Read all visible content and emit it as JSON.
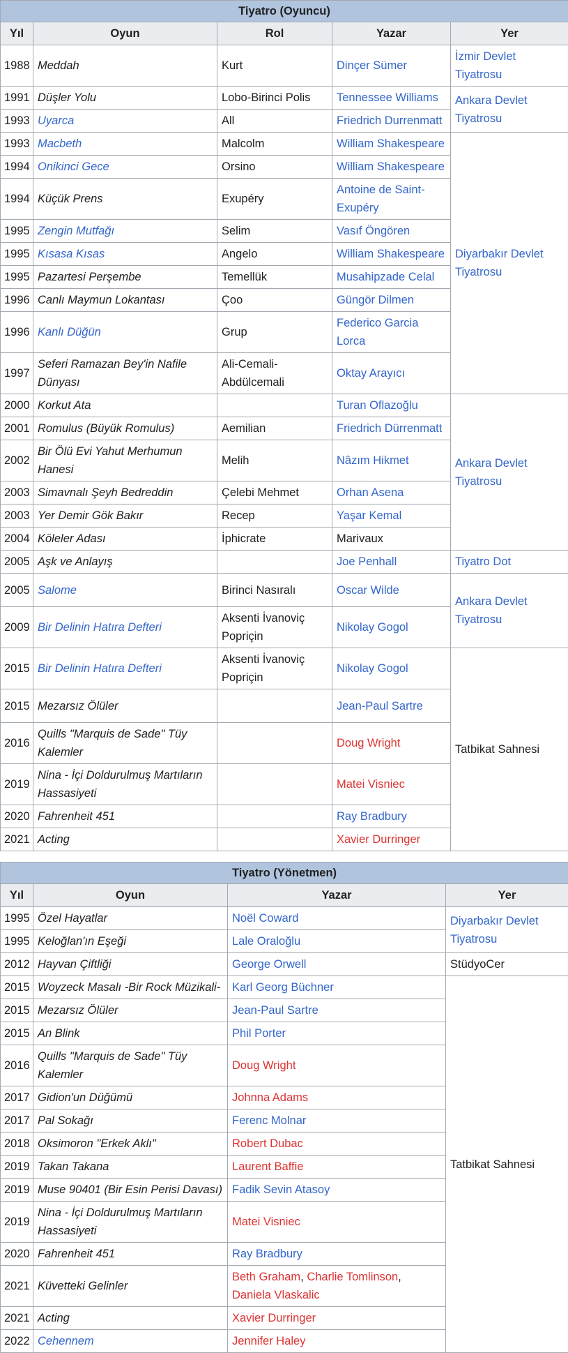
{
  "table_actor": {
    "caption": "Tiyatro (Oyuncu)",
    "headers": [
      "Yıl",
      "Oyun",
      "Rol",
      "Yazar",
      "Yer"
    ],
    "rows": [
      {
        "year": "1988",
        "play": "Meddah",
        "role": "Kurt",
        "author": "Dinçer Sümer",
        "venue": "İzmir Devlet Tiyatrosu"
      },
      {
        "year": "1991",
        "play": "Düşler Yolu",
        "role": "Lobo-Birinci Polis",
        "author": "Tennessee Williams",
        "venue": "Ankara Devlet Tiyatrosu"
      },
      {
        "year": "1993",
        "play": "Uyarca",
        "role": "All",
        "author": "Friedrich Durrenmatt"
      },
      {
        "year": "1993",
        "play": "Macbeth",
        "role": "Malcolm",
        "author": "William Shakespeare",
        "venue": "Diyarbakır Devlet Tiyatrosu"
      },
      {
        "year": "1994",
        "play": "Onikinci Gece",
        "role": "Orsino",
        "author": "William Shakespeare"
      },
      {
        "year": "1994",
        "play": "Küçük Prens",
        "role": "Exupéry",
        "author": "Antoine de Saint-Exupéry"
      },
      {
        "year": "1995",
        "play": "Zengin Mutfağı",
        "role": "Selim",
        "author": "Vasıf Öngören"
      },
      {
        "year": "1995",
        "play": "Kısasa Kısas",
        "role": "Angelo",
        "author": "William Shakespeare"
      },
      {
        "year": "1995",
        "play": "Pazartesi Perşembe",
        "role": "Temellük",
        "author": "Musahipzade Celal"
      },
      {
        "year": "1996",
        "play": "Canlı Maymun Lokantası",
        "role": "Çoo",
        "author": "Güngör Dilmen"
      },
      {
        "year": "1996",
        "play": "Kanlı Düğün",
        "role": "Grup",
        "author": "Federico Garcia Lorca"
      },
      {
        "year": "1997",
        "play": "Seferi Ramazan Bey'in Nafile Dünyası",
        "role": "Ali-Cemali-Abdülcemali",
        "author": "Oktay Arayıcı"
      },
      {
        "year": "2000",
        "play": "Korkut Ata",
        "role": "",
        "author": "Turan Oflazoğlu",
        "venue": "Ankara Devlet Tiyatrosu"
      },
      {
        "year": "2001",
        "play": "Romulus (Büyük Romulus)",
        "role": "Aemilian",
        "author": "Friedrich Dürrenmatt"
      },
      {
        "year": "2002",
        "play": "Bir Ölü Evi Yahut Merhumun Hanesi",
        "role": "Melih",
        "author": "Nâzım Hikmet"
      },
      {
        "year": "2003",
        "play": "Simavnalı Şeyh Bedreddin",
        "role": "Çelebi Mehmet",
        "author": "Orhan Asena"
      },
      {
        "year": "2003",
        "play": "Yer Demir Gök Bakır",
        "role": "Recep",
        "author": "Yaşar Kemal"
      },
      {
        "year": "2004",
        "play": "Köleler Adası",
        "role": "İphicrate",
        "author": "Marivaux"
      },
      {
        "year": "2005",
        "play": "Aşk ve Anlayış",
        "role": "",
        "author": "Joe Penhall",
        "venue": "Tiyatro Dot"
      },
      {
        "year": "2005",
        "play": "Salome",
        "role": "Birinci Nasıralı",
        "author": "Oscar Wilde",
        "venue": "Ankara Devlet Tiyatrosu"
      },
      {
        "year": "2009",
        "play": "Bir Delinin Hatıra Defteri",
        "role": "Aksenti İvanoviç Popriçin",
        "author": "Nikolay Gogol"
      },
      {
        "year": "2015",
        "play": "Bir Delinin Hatıra Defteri",
        "role": "Aksenti İvanoviç Popriçin",
        "author": "Nikolay Gogol",
        "venue": "Tatbikat Sahnesi"
      },
      {
        "year": "2015",
        "play": "Mezarsız Ölüler",
        "role": "",
        "author": "Jean-Paul Sartre"
      },
      {
        "year": "2016",
        "play": "Quills \"Marquis de Sade\" Tüy Kalemler",
        "role": "",
        "author": "Doug Wright"
      },
      {
        "year": "2019",
        "play": "Nina - İçi Doldurulmuş Martıların Hassasiyeti",
        "role": "",
        "author": "Matei Visniec"
      },
      {
        "year": "2020",
        "play": "Fahrenheit 451",
        "role": "",
        "author": "Ray Bradbury"
      },
      {
        "year": "2021",
        "play": "Acting",
        "role": "",
        "author": "Xavier Durringer"
      }
    ]
  },
  "table_director": {
    "caption": "Tiyatro (Yönetmen)",
    "headers": [
      "Yıl",
      "Oyun",
      "Yazar",
      "Yer"
    ],
    "rows": [
      {
        "year": "1995",
        "play": "Özel Hayatlar",
        "author": "Noël Coward",
        "venue": "Diyarbakır Devlet Tiyatrosu"
      },
      {
        "year": "1995",
        "play": "Keloğlan'ın Eşeği",
        "author": "Lale Oraloğlu"
      },
      {
        "year": "2012",
        "play": "Hayvan Çiftliği",
        "author": "George Orwell",
        "venue": "StüdyoCer"
      },
      {
        "year": "2015",
        "play": "Woyzeck Masalı -Bir Rock Müzikali-",
        "author": "Karl Georg Büchner",
        "venue": "Tatbikat Sahnesi"
      },
      {
        "year": "2015",
        "play": "Mezarsız Ölüler",
        "author": "Jean-Paul Sartre"
      },
      {
        "year": "2015",
        "play": "An Blink",
        "author": "Phil Porter"
      },
      {
        "year": "2016",
        "play": "Quills \"Marquis de Sade\" Tüy Kalemler",
        "author": "Doug Wright"
      },
      {
        "year": "2017",
        "play": "Gidion'un Düğümü",
        "author": "Johnna Adams"
      },
      {
        "year": "2017",
        "play": "Pal Sokağı",
        "author": "Ferenc Molnar"
      },
      {
        "year": "2018",
        "play": "Oksimoron \"Erkek Aklı\"",
        "author": "Robert Dubac"
      },
      {
        "year": "2019",
        "play": "Takan Takana",
        "author": "Laurent Baffie"
      },
      {
        "year": "2019",
        "play": "Muse 90401 (Bir Esin Perisi Davası)",
        "author": "Fadik Sevin Atasoy"
      },
      {
        "year": "2019",
        "play": "Nina - İçi Doldurulmuş Martıların Hassasiyeti",
        "author": "Matei Visniec"
      },
      {
        "year": "2020",
        "play": "Fahrenheit 451",
        "author": "Ray Bradbury"
      },
      {
        "year": "2021",
        "play": "Küvetteki Gelinler",
        "authors": [
          "Beth Graham",
          "Charlie Tomlinson",
          "Daniela Vlaskalic"
        ],
        "author_separator": ", "
      },
      {
        "year": "2021",
        "play": "Acting",
        "author": "Xavier Durringer"
      },
      {
        "year": "2022",
        "play": "Cehennem",
        "author": "Jennifer Haley"
      }
    ]
  },
  "colors": {
    "link": "#3366cc",
    "new_link": "#dd3333",
    "text": "#202122",
    "caption_bg": "#b0c4de",
    "header_bg": "#eaecf0",
    "border": "#a2a9b1"
  }
}
